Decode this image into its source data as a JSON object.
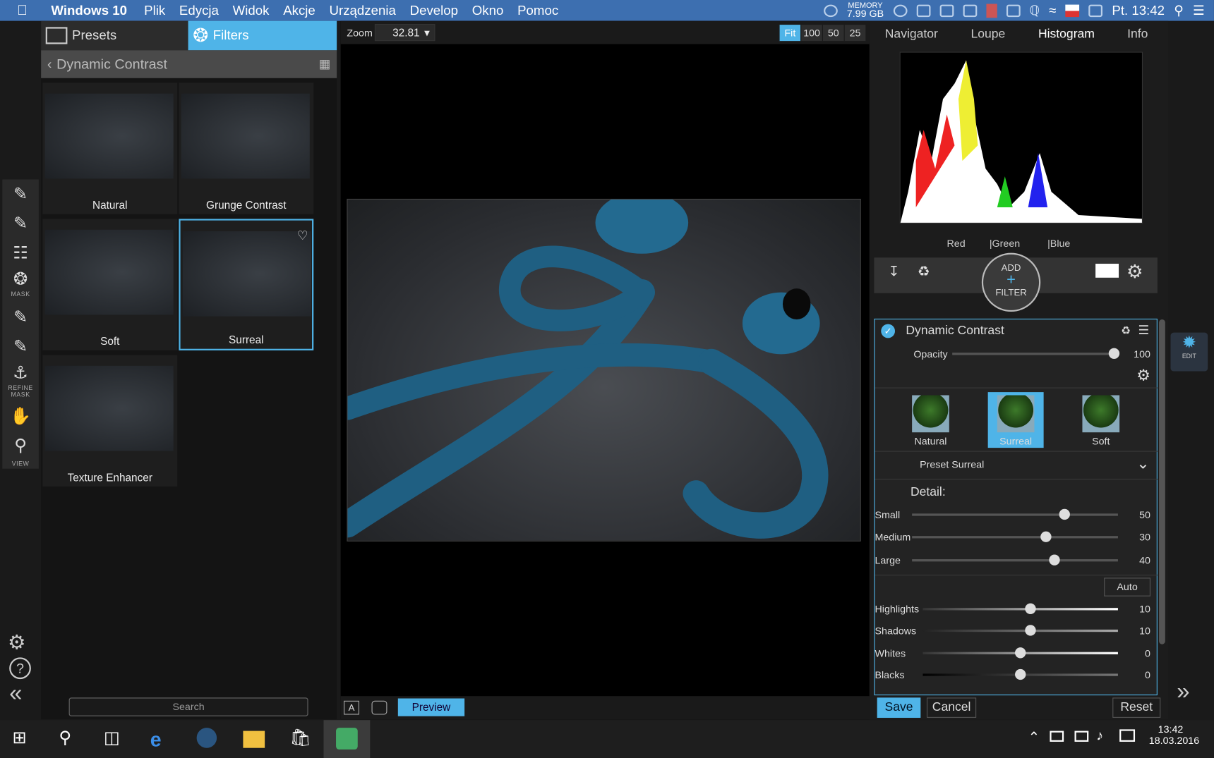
{
  "menubar": {
    "app": "Windows 10",
    "items": [
      "Plik",
      "Edycja",
      "Widok",
      "Akcje",
      "Urządzenia",
      "Develop",
      "Okno",
      "Pomoc"
    ],
    "memory_label": "MEMORY",
    "memory_value": "7.99 GB",
    "clock": "Pt. 13:42"
  },
  "tools": {
    "mask_caption": "MASK",
    "refine_caption": "REFINE MASK",
    "view_caption": "VIEW"
  },
  "left": {
    "tab_presets": "Presets",
    "tab_filters": "Filters",
    "breadcrumb": "Dynamic Contrast",
    "presets": [
      "Natural",
      "Grunge Contrast",
      "Soft",
      "Surreal",
      "Texture Enhancer"
    ],
    "selected": "Surreal",
    "search_placeholder": "Search"
  },
  "center": {
    "zoom_label": "Zoom",
    "zoom_value": "32.81",
    "zoom_buttons": [
      "Fit",
      "100",
      "50",
      "25"
    ],
    "preview": "Preview",
    "btn_a": "A"
  },
  "right": {
    "tabs": [
      "Navigator",
      "Loupe",
      "Histogram",
      "Info"
    ],
    "active_tab": "Histogram",
    "channels": [
      "Red",
      "|Green",
      "|Blue"
    ],
    "add_top": "ADD",
    "add_bottom": "FILTER",
    "filter": {
      "name": "Dynamic Contrast",
      "opacity_label": "Opacity",
      "opacity_value": 100,
      "styles": [
        "Natural",
        "Surreal",
        "Soft"
      ],
      "active_style": "Surreal",
      "preset_label": "Preset Surreal",
      "detail_label": "Detail:",
      "sliders_detail": [
        {
          "label": "Small",
          "value": 50,
          "pos": 0.74
        },
        {
          "label": "Medium",
          "value": 30,
          "pos": 0.65
        },
        {
          "label": "Large",
          "value": 40,
          "pos": 0.69
        }
      ],
      "auto": "Auto",
      "sliders_tone": [
        {
          "label": "Highlights",
          "value": 10,
          "pos": 0.55
        },
        {
          "label": "Shadows",
          "value": 10,
          "pos": 0.55
        },
        {
          "label": "Whites",
          "value": 0,
          "pos": 0.5
        },
        {
          "label": "Blacks",
          "value": 0,
          "pos": 0.5
        }
      ]
    },
    "save": "Save",
    "cancel": "Cancel",
    "reset": "Reset",
    "edit_caption": "EDIT"
  },
  "taskbar": {
    "time": "13:42",
    "date": "18.03.2016"
  },
  "colors": {
    "accent": "#4fb4e8",
    "menubar": "#3d6fb0"
  }
}
